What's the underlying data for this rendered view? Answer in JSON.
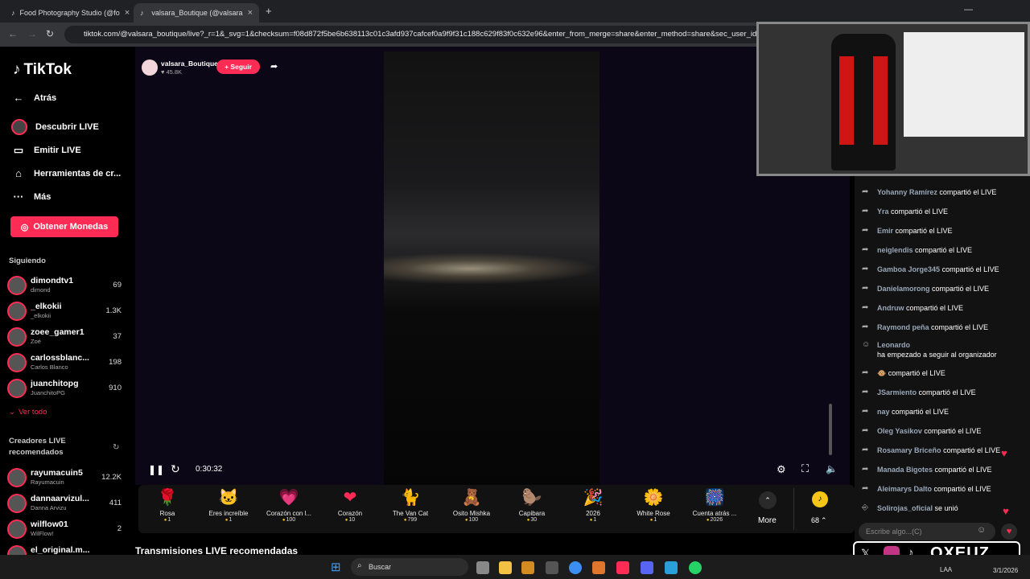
{
  "browser": {
    "tabs": [
      {
        "label": "Food Photography Studio (@fo"
      },
      {
        "label": "valsara_Boutique (@valsara"
      }
    ],
    "url": "tiktok.com/@valsara_boutique/live?_r=1&_svg=1&checksum=f08d872f5be6b638113c01c3afd937cafcef0a9f9f31c188c629f83f0c632e96&enter_from_merge=share&enter_method=share&sec_user_id=MS"
  },
  "sidebar": {
    "logo": "TikTok",
    "back": "Atrás",
    "nav": [
      {
        "label": "Descubrir LIVE"
      },
      {
        "label": "Emitir LIVE"
      },
      {
        "label": "Herramientas de cr..."
      },
      {
        "label": "Más"
      }
    ],
    "coins_button": "Obtener Monedas",
    "following_title": "Siguiendo",
    "following": [
      {
        "name": "dimondtv1",
        "sub": "dimond",
        "count": "69"
      },
      {
        "name": "_elkokii",
        "sub": "_elkokii",
        "count": "1.3K"
      },
      {
        "name": "zoee_gamer1",
        "sub": "Zoé",
        "count": "37"
      },
      {
        "name": "carlossblanc...",
        "sub": "Carlos Blanco",
        "count": "198"
      },
      {
        "name": "juanchitopg",
        "sub": "JuanchitoPG",
        "count": "910"
      }
    ],
    "see_all": "Ver todo",
    "recommended_title": "Creadores LIVE recomendados",
    "recommended": [
      {
        "name": "rayumacuin5",
        "sub": "Rayumacuin",
        "count": "12.2K"
      },
      {
        "name": "dannaarvizul...",
        "sub": "Danna Arvizu",
        "count": "411"
      },
      {
        "name": "wilflow01",
        "sub": "WilFlow!",
        "count": "2"
      },
      {
        "name": "el_original.m...",
        "sub": "",
        "count": ""
      }
    ]
  },
  "stream": {
    "host": "valsara_Boutique",
    "likes": "45.8K",
    "follow": "+ Seguir",
    "time": "0:30:32"
  },
  "gifts": [
    {
      "name": "Rosa",
      "price": "1",
      "icon": "🌹"
    },
    {
      "name": "Eres increíble",
      "price": "1",
      "icon": "🐱"
    },
    {
      "name": "Corazón con l...",
      "price": "100",
      "icon": "💗"
    },
    {
      "name": "Corazón",
      "price": "10",
      "icon": "❤"
    },
    {
      "name": "The Van Cat",
      "price": "799",
      "icon": "🐈"
    },
    {
      "name": "Osito Mishka",
      "price": "100",
      "icon": "🧸"
    },
    {
      "name": "Capibara",
      "price": "30",
      "icon": "🦫"
    },
    {
      "name": "2026",
      "price": "1",
      "icon": "🎉"
    },
    {
      "name": "White Rose",
      "price": "1",
      "icon": "🌼"
    },
    {
      "name": "Cuenta atrás ...",
      "price": "2026",
      "icon": "🎆"
    }
  ],
  "more_label": "More",
  "coin_count": "68",
  "recommended_live": "Transmisiones LIVE recomendadas",
  "chat": [
    {
      "user": "Yohanny Ramírez",
      "text": "compartió el LIVE"
    },
    {
      "user": "Yra",
      "text": "compartió el LIVE"
    },
    {
      "user": "Emir",
      "text": "compartió el LIVE"
    },
    {
      "user": "neiglendis",
      "text": "compartió el LIVE"
    },
    {
      "user": "Gamboa Jorge345",
      "text": "compartió el LIVE"
    },
    {
      "user": "Danielamorong",
      "text": "compartió el LIVE"
    },
    {
      "user": "Andruw",
      "text": "compartió el LIVE"
    },
    {
      "user": "Raymond peña",
      "text": "compartió el LIVE"
    },
    {
      "user": "Leonardo",
      "text": "ha empezado a seguir al organizador"
    },
    {
      "user": "",
      "text": "compartió el LIVE"
    },
    {
      "user": "JSarmiento",
      "text": "compartió el LIVE"
    },
    {
      "user": "nay",
      "text": "compartió el LIVE"
    },
    {
      "user": "Oleg Yasikov",
      "text": "compartió el LIVE"
    },
    {
      "user": "Rosamary Briceño",
      "text": "compartió el LIVE"
    },
    {
      "user": "Manada Bigotes",
      "text": "compartió el LIVE"
    },
    {
      "user": "Aleimarys Dalto",
      "text": "compartió el LIVE"
    },
    {
      "user": "Solirojas_oficial",
      "text": "se unió"
    }
  ],
  "chat_placeholder": "Escribe algo...(C)",
  "taskbar": {
    "search": "Buscar",
    "lang": "LAA",
    "date": "3/1/2026"
  },
  "overlay": {
    "brand": "OXEUZ"
  }
}
